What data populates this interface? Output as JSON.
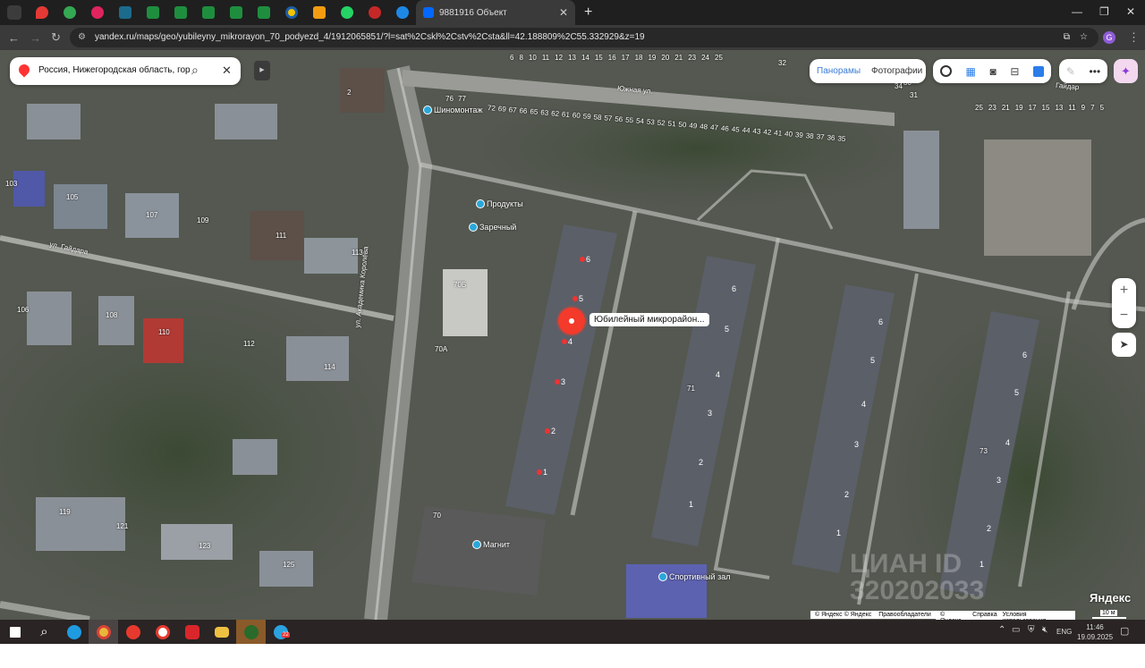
{
  "browser": {
    "active_tab_title": "9881916 Объект",
    "new_tab": "+",
    "url": "yandex.ru/maps/geo/yubileyny_mikrorayon_70_podyezd_4/1912065851/?l=sat%2Cskl%2Cstv%2Csta&ll=42.188809%2C55.332929&z=19",
    "profile_initial": "G"
  },
  "search": {
    "value": "Россия, Нижегородская область, гор"
  },
  "layers": {
    "panoramas": "Панорамы",
    "photos": "Фотографии"
  },
  "map": {
    "selected_label": "Юбилейный микрорайон...",
    "pois": [
      "Шиномонтаж",
      "Продукты",
      "Заречный",
      "Магнит",
      "Спортивный зал"
    ],
    "streets": [
      "Южная ул.",
      "ул. Гайдара",
      "ул. Академика Королёва",
      "Гайдар"
    ],
    "house_numbers": [
      "103",
      "105",
      "107",
      "109",
      "111",
      "113",
      "106",
      "108",
      "110",
      "112",
      "114",
      "119",
      "121",
      "123",
      "125",
      "70",
      "70А",
      "70Б",
      "71",
      "73",
      "2",
      "6",
      "8",
      "10",
      "11",
      "12",
      "13",
      "14",
      "15",
      "16",
      "17",
      "18",
      "19",
      "20",
      "21",
      "23",
      "24",
      "25",
      "76",
      "77",
      "72",
      "69",
      "67",
      "66",
      "65",
      "63",
      "62",
      "61",
      "60",
      "59",
      "58",
      "57",
      "56",
      "55",
      "54",
      "53",
      "52",
      "51",
      "50",
      "49",
      "48",
      "47",
      "46",
      "45",
      "44",
      "43",
      "42",
      "41",
      "40",
      "39",
      "38",
      "37",
      "36",
      "35",
      "34",
      "32",
      "30",
      "31",
      "25",
      "23",
      "21",
      "19",
      "17",
      "15",
      "13",
      "11",
      "9",
      "7",
      "5"
    ],
    "entrances_b70": [
      "6",
      "5",
      "4",
      "3",
      "2",
      "1"
    ],
    "entrances_b71": [
      "6",
      "5",
      "4",
      "3",
      "2",
      "1"
    ],
    "entrances_b72": [
      "6",
      "5",
      "4",
      "3",
      "2",
      "1"
    ],
    "entrances_b73": [
      "6",
      "5",
      "4",
      "3",
      "2",
      "1"
    ],
    "watermark": "ЦИАН ID 320202033",
    "logo": "Яндекс",
    "scale": "10 м",
    "copyright1": [
      "© Яндекс © Яндекс",
      "Правообладатели"
    ],
    "copyright2": [
      "© Яндекс",
      "Справка",
      "Условия использования"
    ]
  },
  "taskbar": {
    "lang": "ENG",
    "time": "11:46",
    "date": "19.09.2025",
    "telegram_badge": "22"
  }
}
